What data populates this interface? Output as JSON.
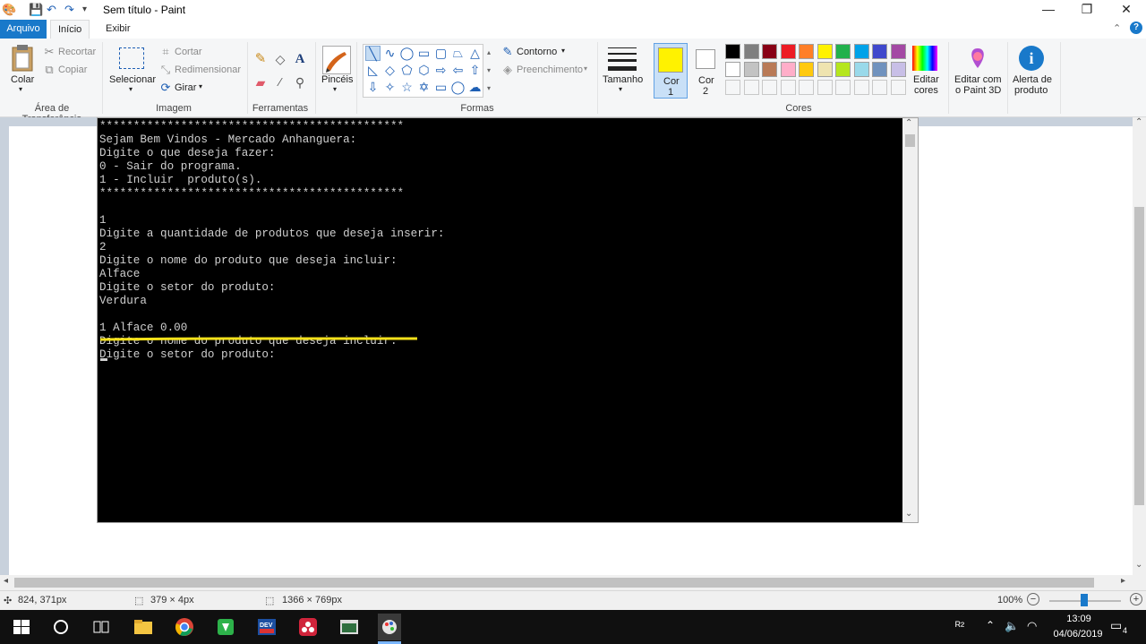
{
  "window": {
    "title": "Sem título - Paint",
    "minimize": "—",
    "restore": "❐",
    "close": "✕"
  },
  "tabs": {
    "file": "Arquivo",
    "home": "Início",
    "view": "Exibir"
  },
  "ribbon": {
    "clipboard": {
      "paste": "Colar",
      "cut": "Recortar",
      "copy": "Copiar",
      "group": "Área de Transferência"
    },
    "image": {
      "select": "Selecionar",
      "crop": "Cortar",
      "resize": "Redimensionar",
      "rotate": "Girar",
      "group": "Imagem"
    },
    "tools": {
      "group": "Ferramentas",
      "text_icon": "A"
    },
    "brushes": {
      "label": "Pincéis"
    },
    "shapes": {
      "outline": "Contorno",
      "fill": "Preenchimento",
      "group": "Formas"
    },
    "size": {
      "label": "Tamanho"
    },
    "color1": {
      "label": "Cor",
      "num": "1",
      "value": "#fff200"
    },
    "color2": {
      "label": "Cor",
      "num": "2",
      "value": "#ffffff"
    },
    "colors": {
      "group": "Cores",
      "palette_row1": [
        "#000000",
        "#7f7f7f",
        "#880015",
        "#ed1c24",
        "#ff7f27",
        "#fff200",
        "#22b14c",
        "#00a2e8",
        "#3f48cc",
        "#a349a4"
      ],
      "palette_row2": [
        "#ffffff",
        "#c3c3c3",
        "#b97a57",
        "#ffaec9",
        "#ffc90e",
        "#efe4b0",
        "#b5e61d",
        "#99d9ea",
        "#7092be",
        "#c8bfe7"
      ],
      "edit": "Editar cores",
      "edit_line1": "Editar",
      "edit_line2": "cores"
    },
    "paint3d": {
      "line1": "Editar com",
      "line2": "o Paint 3D"
    },
    "alert": {
      "line1": "Alerta de",
      "line2": "produto"
    }
  },
  "console": {
    "lines": [
      "*********************************************",
      "Sejam Bem Vindos - Mercado Anhanguera:",
      "Digite o que deseja fazer:",
      "0 - Sair do programa.",
      "1 - Incluir  produto(s).",
      "*********************************************",
      "",
      "1",
      "Digite a quantidade de produtos que deseja inserir:",
      "2",
      "Digite o nome do produto que deseja incluir:",
      "Alface",
      "Digite o setor do produto:",
      "Verdura",
      "",
      "1 Alface 0.00",
      "Digite o nome do produto que deseja incluir:",
      "Digite o setor do produto:"
    ]
  },
  "status": {
    "cursor_pos": "824, 371px",
    "selection_size": "379 × 4px",
    "image_size": "1366 × 769px",
    "zoom": "100%"
  },
  "taskbar": {
    "time": "13:09",
    "date": "04/06/2019",
    "notifications": "4"
  }
}
